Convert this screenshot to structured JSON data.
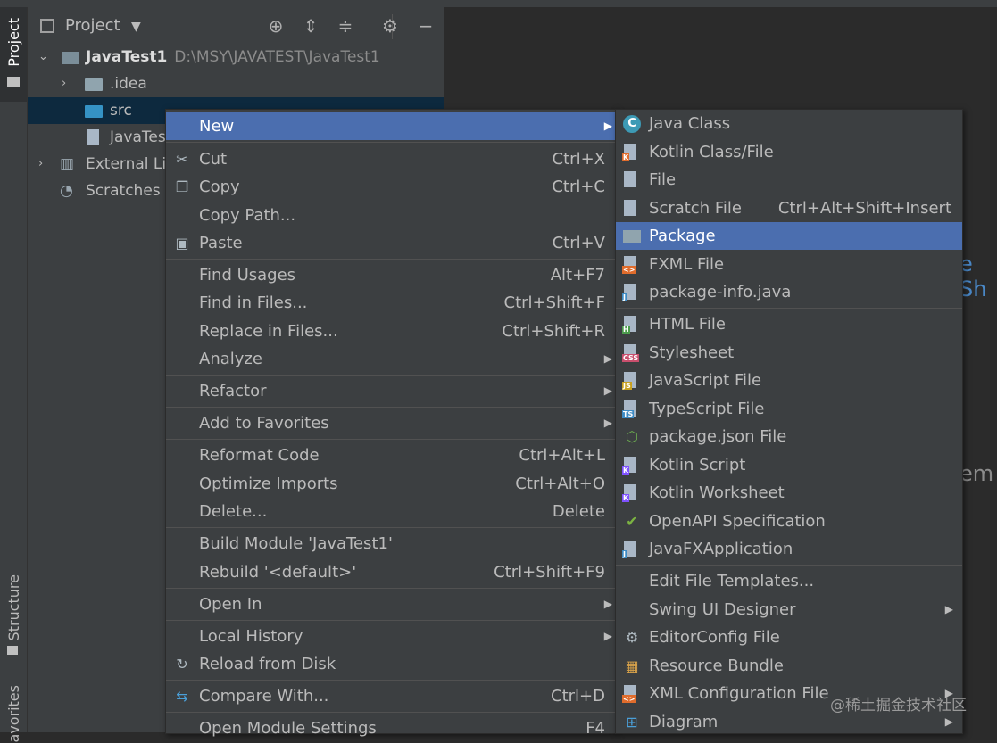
{
  "sidebar": {
    "project_tab": "Project",
    "structure_tab": "Structure",
    "favorites_tab": "avorites"
  },
  "panel": {
    "title": "Project",
    "tree": {
      "root_name": "JavaTest1",
      "root_path": "D:\\MSY\\JAVATEST\\JavaTest1",
      "idea": ".idea",
      "src": "src",
      "iml": "JavaTes",
      "external": "External Li",
      "scratches": "Scratches a"
    }
  },
  "editor_hints": {
    "a": "e Sh",
    "b": "em"
  },
  "context_menu": {
    "items": [
      {
        "label": "New",
        "shortcut": ""
      },
      {
        "label": "Cut",
        "shortcut": "Ctrl+X"
      },
      {
        "label": "Copy",
        "shortcut": "Ctrl+C"
      },
      {
        "label": "Copy Path...",
        "shortcut": ""
      },
      {
        "label": "Paste",
        "shortcut": "Ctrl+V"
      },
      {
        "label": "Find Usages",
        "shortcut": "Alt+F7"
      },
      {
        "label": "Find in Files...",
        "shortcut": "Ctrl+Shift+F"
      },
      {
        "label": "Replace in Files...",
        "shortcut": "Ctrl+Shift+R"
      },
      {
        "label": "Analyze",
        "shortcut": ""
      },
      {
        "label": "Refactor",
        "shortcut": ""
      },
      {
        "label": "Add to Favorites",
        "shortcut": ""
      },
      {
        "label": "Reformat Code",
        "shortcut": "Ctrl+Alt+L"
      },
      {
        "label": "Optimize Imports",
        "shortcut": "Ctrl+Alt+O"
      },
      {
        "label": "Delete...",
        "shortcut": "Delete"
      },
      {
        "label": "Build Module 'JavaTest1'",
        "shortcut": ""
      },
      {
        "label": "Rebuild '<default>'",
        "shortcut": "Ctrl+Shift+F9"
      },
      {
        "label": "Open In",
        "shortcut": ""
      },
      {
        "label": "Local History",
        "shortcut": ""
      },
      {
        "label": "Reload from Disk",
        "shortcut": ""
      },
      {
        "label": "Compare With...",
        "shortcut": "Ctrl+D"
      },
      {
        "label": "Open Module Settings",
        "shortcut": "F4"
      }
    ]
  },
  "new_submenu": {
    "items": [
      {
        "label": "Java Class",
        "shortcut": ""
      },
      {
        "label": "Kotlin Class/File",
        "shortcut": ""
      },
      {
        "label": "File",
        "shortcut": ""
      },
      {
        "label": "Scratch File",
        "shortcut": "Ctrl+Alt+Shift+Insert"
      },
      {
        "label": "Package",
        "shortcut": ""
      },
      {
        "label": "FXML File",
        "shortcut": ""
      },
      {
        "label": "package-info.java",
        "shortcut": ""
      },
      {
        "label": "HTML File",
        "shortcut": ""
      },
      {
        "label": "Stylesheet",
        "shortcut": ""
      },
      {
        "label": "JavaScript File",
        "shortcut": ""
      },
      {
        "label": "TypeScript File",
        "shortcut": ""
      },
      {
        "label": "package.json File",
        "shortcut": ""
      },
      {
        "label": "Kotlin Script",
        "shortcut": ""
      },
      {
        "label": "Kotlin Worksheet",
        "shortcut": ""
      },
      {
        "label": "OpenAPI Specification",
        "shortcut": ""
      },
      {
        "label": "JavaFXApplication",
        "shortcut": ""
      },
      {
        "label": "Edit File Templates...",
        "shortcut": ""
      },
      {
        "label": "Swing UI Designer",
        "shortcut": ""
      },
      {
        "label": "EditorConfig File",
        "shortcut": ""
      },
      {
        "label": "Resource Bundle",
        "shortcut": ""
      },
      {
        "label": "XML Configuration File",
        "shortcut": ""
      },
      {
        "label": "Diagram",
        "shortcut": ""
      }
    ]
  },
  "file_tags": {
    "fxml": "<>",
    "java": "J",
    "html": "H",
    "css": "CSS",
    "js": "JS",
    "ts": "TS",
    "xml": "<>",
    "kt": "K"
  },
  "watermark": "@稀土掘金技术社区"
}
